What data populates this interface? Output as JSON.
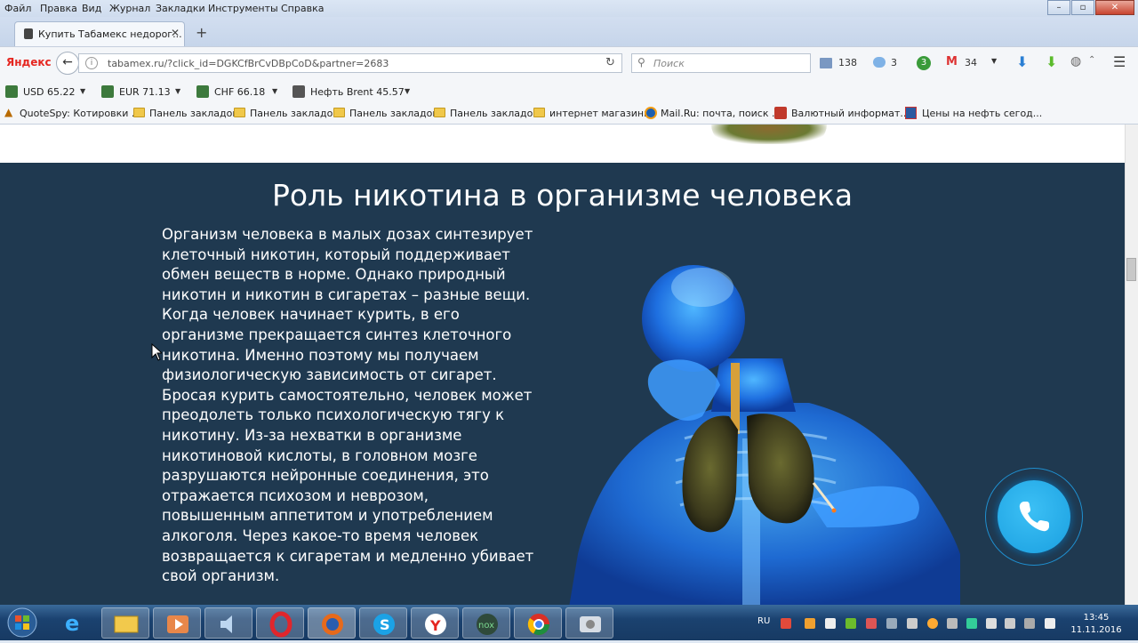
{
  "menubar": {
    "items": [
      "Файл",
      "Правка",
      "Вид",
      "Журнал",
      "Закладки",
      "Инструменты",
      "Справка"
    ]
  },
  "tabs": [
    {
      "title": "Купить Табамекс недорог..."
    }
  ],
  "navbar": {
    "brand": "Яндекс",
    "url": "tabamex.ru/?click_id=DGKCfBrCvDBpCoD&partner=2683",
    "search_placeholder": "Поиск",
    "mail_count": "138",
    "weather": "3",
    "counter": "3",
    "gmail_count": "34"
  },
  "currency": [
    {
      "label": "USD 65.22"
    },
    {
      "label": "EUR 71.13"
    },
    {
      "label": "CHF 66.18"
    },
    {
      "label": "Нефть Brent 45.57"
    }
  ],
  "bookmarks": [
    {
      "label": "QuoteSpy: Котировки ...",
      "icon": "warning-icon"
    },
    {
      "label": "Панель закладок",
      "icon": "folder-icon"
    },
    {
      "label": "Панель закладок",
      "icon": "folder-icon"
    },
    {
      "label": "Панель закладок",
      "icon": "folder-icon"
    },
    {
      "label": "Панель закладок",
      "icon": "folder-icon"
    },
    {
      "label": "интернет магазины",
      "icon": "folder-icon"
    },
    {
      "label": "Mail.Ru: почта, поиск ...",
      "icon": "mailru-icon"
    },
    {
      "label": "Валютный информат...",
      "icon": "forex-icon"
    },
    {
      "label": "Цены на нефть сегод...",
      "icon": "page-icon"
    }
  ],
  "page": {
    "heading": "Роль никотина в организме человека",
    "paragraph": "Организм человека в малых дозах синтезирует клеточный никотин, который поддерживает обмен веществ в норме. Однако природный никотин и никотин в сигаретах – разные вещи. Когда человек начинает курить, в его организме прекращается синтез клеточного никотина. Именно поэтому мы получаем физиологическую зависимость от сигарет. Бросая курить самостоятельно, человек может преодолеть только психологическую тягу к никотину. Из-за нехватки в организме никотиновой кислоты, в головном мозге разрушаются нейронные соединения, это отражается психозом и неврозом, повышенным аппетитом и употреблением алкоголя. Через какое-то время человек возвращается к сигаретам и медленно убивает свой организм."
  },
  "taskbar": {
    "apps": [
      "internet-explorer",
      "file-explorer",
      "media-player",
      "volume-app",
      "opera",
      "firefox",
      "skype",
      "yandex-browser",
      "nox",
      "chrome",
      "media-center"
    ],
    "lang": "RU",
    "time": "13:45",
    "date": "11.11.2016"
  },
  "colors": {
    "page_bg": "#1f3950",
    "call_button": "#1a9fe0",
    "text": "#ffffff"
  }
}
